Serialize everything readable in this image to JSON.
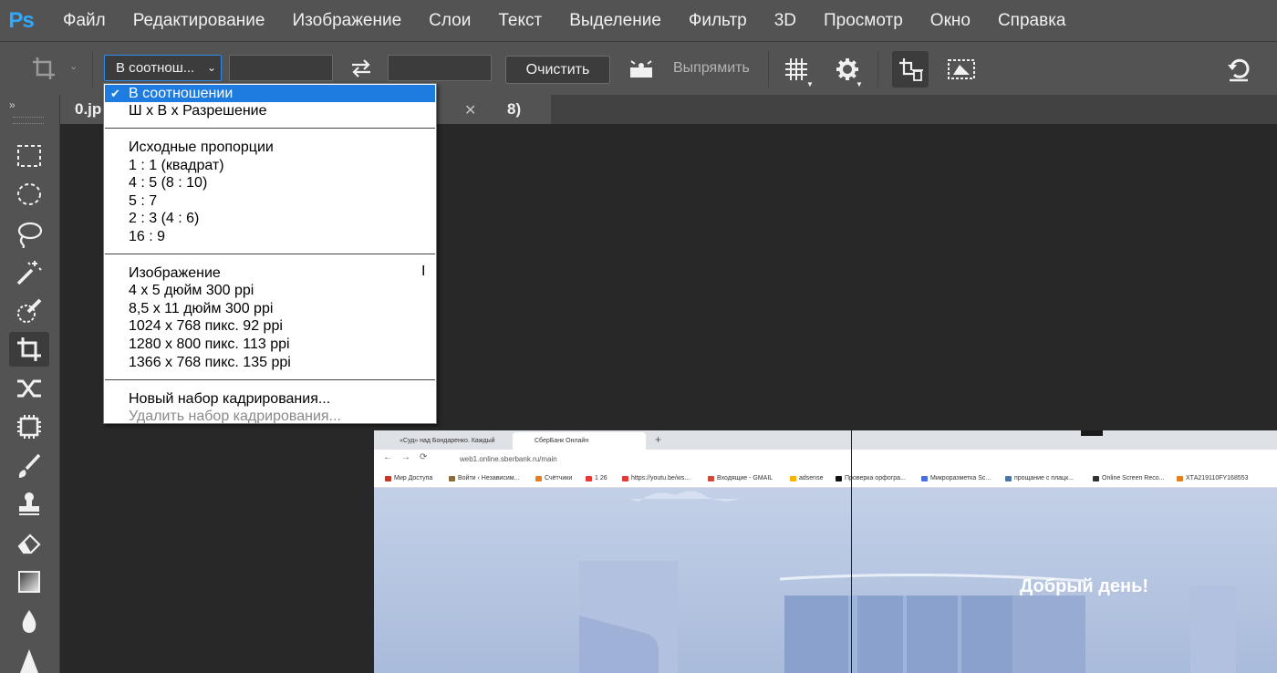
{
  "menubar": {
    "logo": "Ps",
    "items": [
      "Файл",
      "Редактирование",
      "Изображение",
      "Слои",
      "Текст",
      "Выделение",
      "Фильтр",
      "3D",
      "Просмотр",
      "Окно",
      "Справка"
    ]
  },
  "options": {
    "ratio_value": "В соотношении",
    "ratio_display": "В соотнош...",
    "width_value": "",
    "height_value": "",
    "clear_label": "Очистить",
    "straighten_label": "Выпрямить"
  },
  "toolbar": {
    "tools": [
      "rectangular-marquee-tool",
      "elliptical-marquee-tool",
      "lasso-tool",
      "magic-wand-tool",
      "quick-selection-tool",
      "crop-tool",
      "content-aware-move-tool",
      "frame-tool",
      "brush-tool",
      "clone-stamp-tool",
      "eraser-tool",
      "gradient-tool",
      "blur-tool",
      "sharpen-tool"
    ],
    "active": "crop-tool"
  },
  "tabs": {
    "doc1": "0.jp",
    "doc2_suffix": "8)"
  },
  "dropdown": {
    "groups": [
      [
        "В соотношении",
        "Ш x В x Разрешение"
      ],
      [
        "Исходные пропорции",
        "1 : 1 (квадрат)",
        "4 : 5 (8 : 10)",
        "5 : 7",
        "2 : 3 (4 : 6)",
        "16 : 9"
      ],
      [
        "Изображение",
        "4 x 5 дюйм 300 ppi",
        "8,5 x 11 дюйм 300 ppi",
        "1024 x 768 пикс. 92 ppi",
        "1280 x 800 пикс. 113 ppi",
        "1366 x 768 пикс. 135 ppi"
      ],
      [
        "Новый набор кадрирования...",
        "Удалить набор кадрирования..."
      ]
    ],
    "selected": "В соотношении",
    "disabled": "Удалить набор кадрирования..."
  },
  "browser": {
    "tab1": "«Суд» над Бондаренко. Каждый",
    "tab2": "СберБанк Онлайн",
    "url": "web1.online.sberbank.ru/main",
    "bookmarks": [
      "Мир Доступа",
      "Войти ‹ Независим...",
      "Счётчики",
      "1 26",
      "https://youtu.be/ws...",
      "Входящие - GMAIL",
      "adsense",
      "Проверка орфогра...",
      "Микроразметка Sc...",
      "прощание с плацк...",
      "Online Screen Reco...",
      "ХТА219110FY168553"
    ],
    "greeting": "Добрый день!"
  },
  "colors": {
    "ui_bg": "#535353",
    "canvas_bg": "#282828",
    "accent": "#1e7be0",
    "ps_blue": "#31a8ff"
  }
}
